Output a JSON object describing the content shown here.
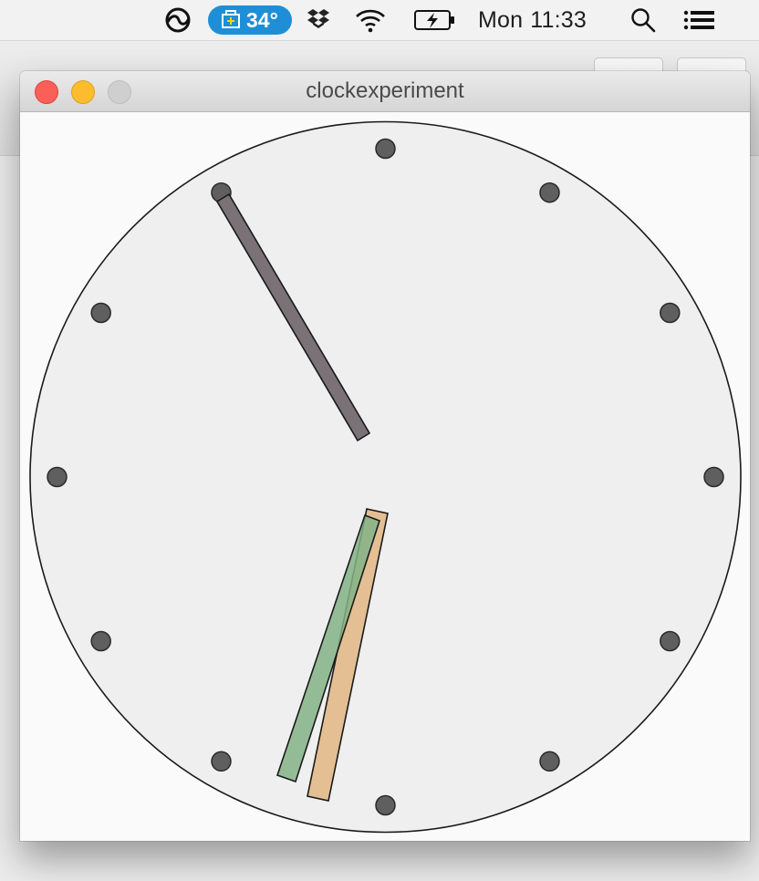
{
  "menubar": {
    "temperature": "34°",
    "day": "Mon",
    "time": "11:33",
    "icons": [
      "creative-cloud-icon",
      "temperature-monitor-icon",
      "dropbox-icon",
      "wifi-icon",
      "battery-charging-icon",
      "spotlight-search-icon",
      "notification-center-icon"
    ]
  },
  "window": {
    "title": "clockexperiment"
  },
  "clock": {
    "face_color": "#efefef",
    "marker_color": "#5f5f5f",
    "marker_count": 12,
    "hour_hand_color": "#7a7276",
    "minute_hand_color": "#e0b682",
    "second_hand_color": "#82b386"
  }
}
